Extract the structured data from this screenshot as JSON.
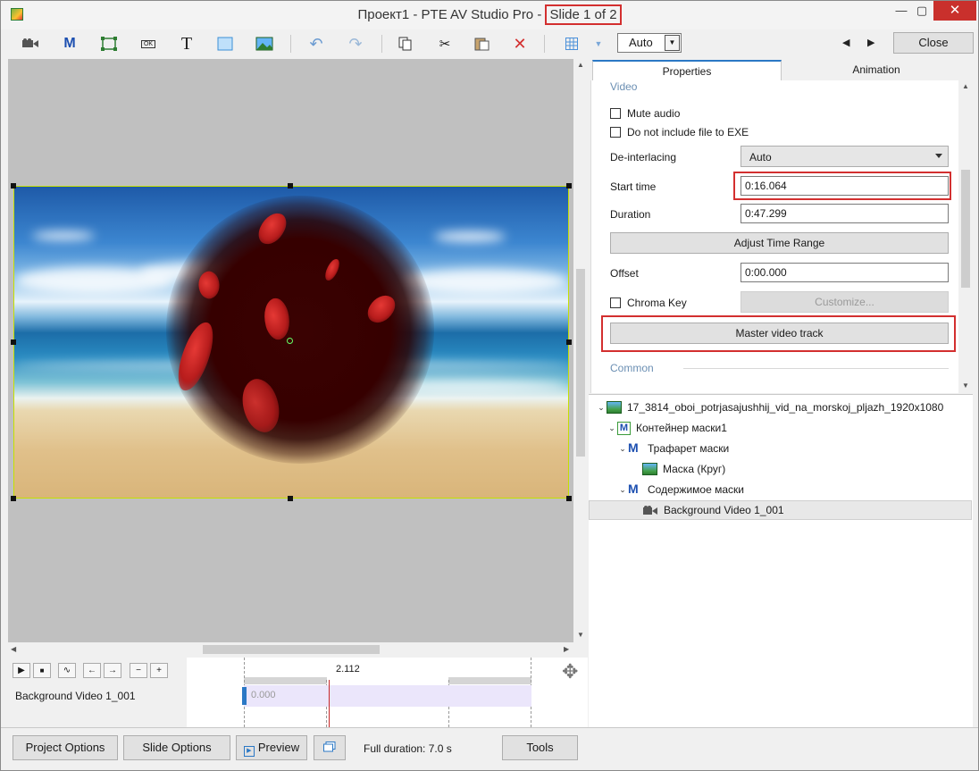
{
  "window": {
    "title_prefix": "Проект1 - PTE AV Studio Pro - ",
    "title_slide": "Slide 1 of 2",
    "min": "—",
    "max": "▢",
    "close": "✕"
  },
  "toolbar": {
    "icons": [
      "video-camera-icon",
      "mask-m-icon",
      "frame-icon",
      "button-ok-icon",
      "text-t-icon",
      "rectangle-icon",
      "image-icon",
      "undo-icon",
      "redo-icon",
      "copy-icon",
      "cut-icon",
      "paste-icon",
      "delete-icon",
      "grid-icon",
      "grid-dropdown-icon"
    ],
    "m_label": "M",
    "ok_label": "OK",
    "t_label": "T",
    "zoom_value": "Auto",
    "prev": "◀",
    "next": "▶",
    "close_label": "Close"
  },
  "tabs": {
    "properties": "Properties",
    "animation": "Animation"
  },
  "properties": {
    "section_video": "Video",
    "mute_audio": "Mute audio",
    "no_exe": "Do not include file to EXE",
    "deinterlacing_label": "De-interlacing",
    "deinterlacing_value": "Auto",
    "start_time_label": "Start time",
    "start_time_value": "0:16.064",
    "duration_label": "Duration",
    "duration_value": "0:47.299",
    "adjust_time_range": "Adjust Time Range",
    "offset_label": "Offset",
    "offset_value": "0:00.000",
    "chroma_key": "Chroma Key",
    "customize": "Customize...",
    "master_video_track": "Master video track",
    "section_common": "Common"
  },
  "tree": {
    "items": [
      {
        "label": "17_3814_oboi_potrjasajushhij_vid_na_morskoj_pljazh_1920x1080",
        "icon": "image-icon"
      },
      {
        "label": "Контейнер маски1",
        "icon": "mask-container-icon"
      },
      {
        "label": "Трафарет маски",
        "icon": "mask-stencil-icon"
      },
      {
        "label": "Маска (Круг)",
        "icon": "image-icon"
      },
      {
        "label": "Содержимое маски",
        "icon": "mask-content-icon"
      },
      {
        "label": "Background Video 1_001",
        "icon": "video-camera-icon"
      }
    ]
  },
  "timeline": {
    "current_time": "2.112",
    "track_label": "Background Video 1_001",
    "clip_value": "0.000"
  },
  "bottom": {
    "project_options": "Project Options",
    "slide_options": "Slide Options",
    "preview": "Preview",
    "full_duration": "Full duration: 7.0 s",
    "tools": "Tools"
  },
  "colors": {
    "highlight_red": "#d32f2f",
    "accent_blue": "#2b78c5",
    "canvas_grey": "#c0c0c0"
  }
}
